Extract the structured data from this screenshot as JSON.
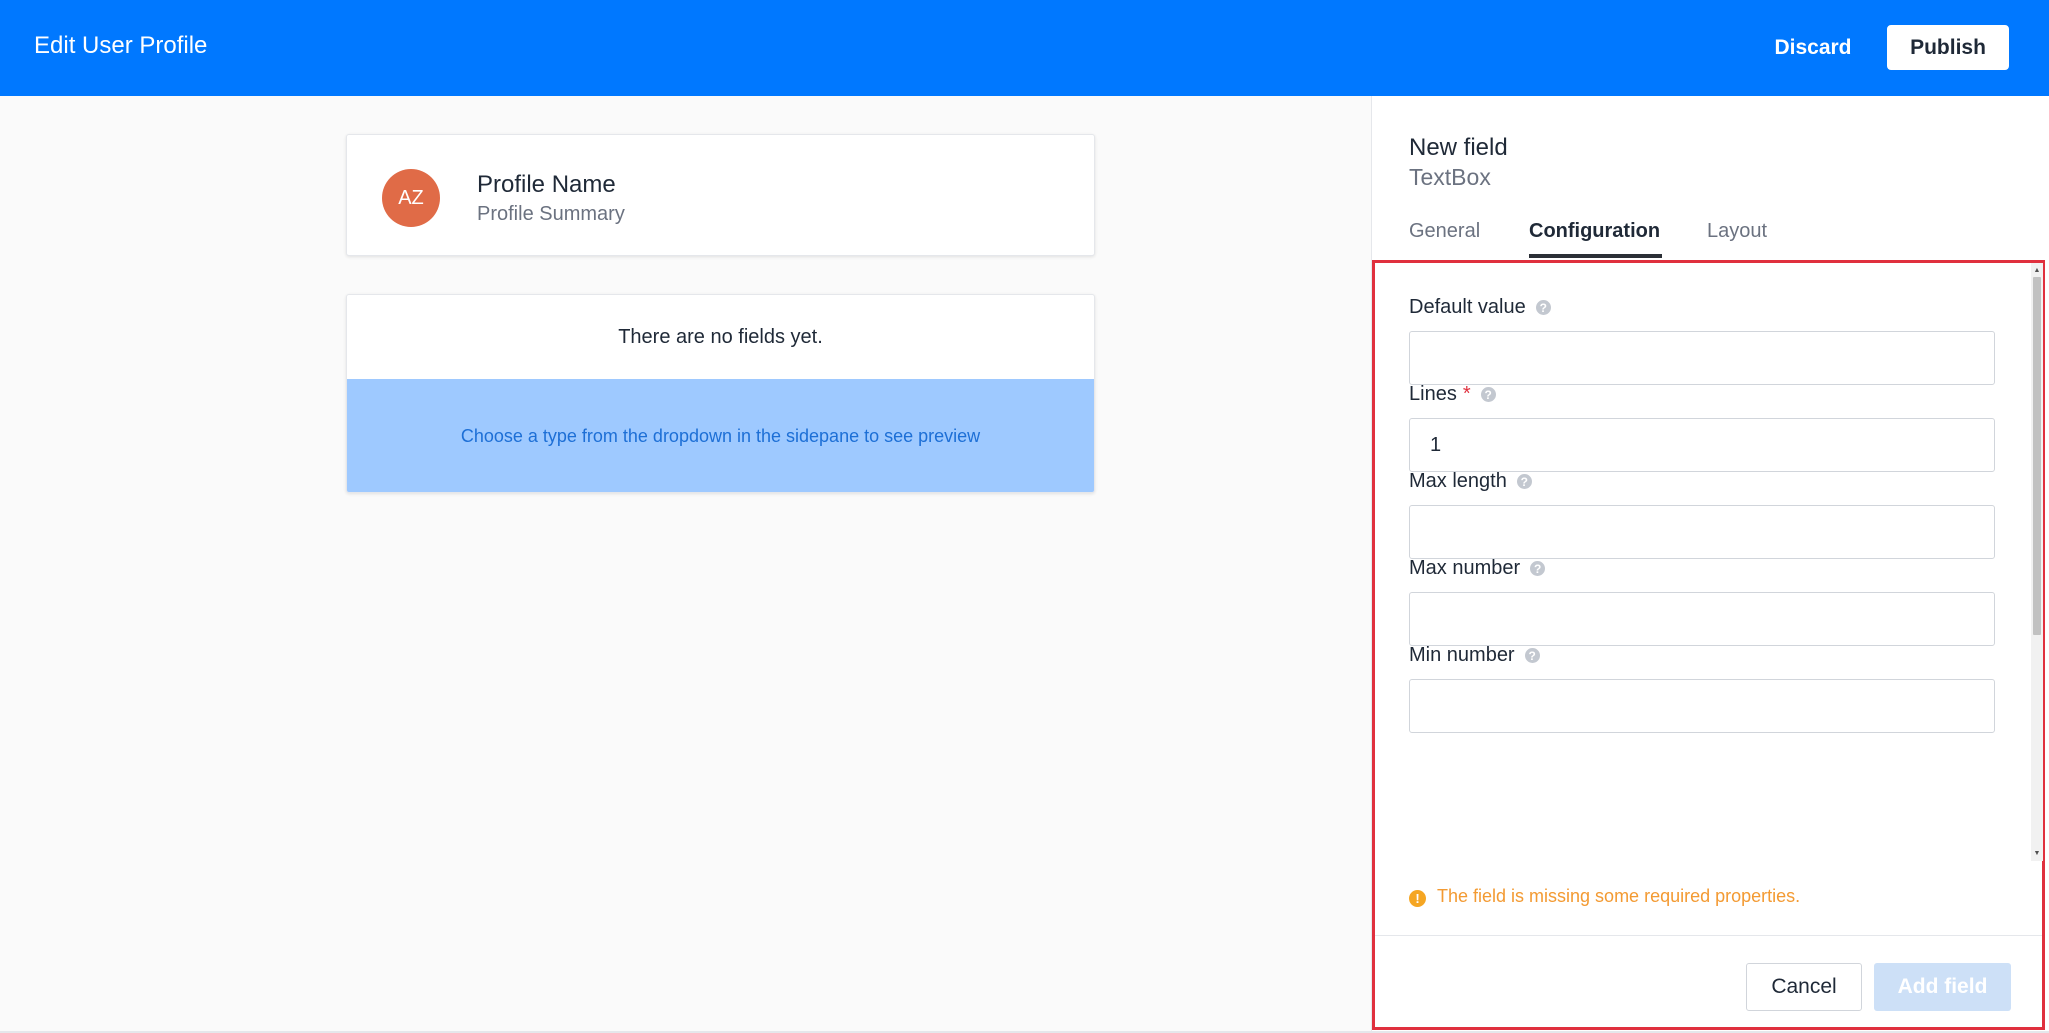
{
  "header": {
    "title": "Edit User Profile",
    "discard_label": "Discard",
    "publish_label": "Publish"
  },
  "colors": {
    "header_bg": "#0078ff",
    "avatar_bg": "#e06b47",
    "preview_bg": "#9ec9ff",
    "warning": "#f39a32",
    "highlight_border": "#e0303e"
  },
  "profile": {
    "initials": "AZ",
    "name": "Profile Name",
    "summary": "Profile Summary"
  },
  "fields_area": {
    "empty_message": "There are no fields yet.",
    "preview_hint": "Choose a type from the dropdown in the sidepane to see preview"
  },
  "sidepane": {
    "title": "New field",
    "type": "TextBox",
    "tabs": [
      {
        "label": "General",
        "active": false
      },
      {
        "label": "Configuration",
        "active": true
      },
      {
        "label": "Layout",
        "active": false
      }
    ],
    "form": {
      "fields": [
        {
          "label": "Default value",
          "required": false,
          "value": "",
          "help_icon": "question-circle-icon"
        },
        {
          "label": "Lines",
          "required": true,
          "required_mark": "*",
          "value": "1",
          "help_icon": "question-circle-icon"
        },
        {
          "label": "Max length",
          "required": false,
          "value": "",
          "help_icon": "question-circle-icon"
        },
        {
          "label": "Max number",
          "required": false,
          "value": "",
          "help_icon": "question-circle-icon"
        },
        {
          "label": "Min number",
          "required": false,
          "value": "",
          "help_icon": "question-circle-icon"
        }
      ]
    },
    "warning": {
      "icon": "exclamation-circle-icon",
      "text": "The field is missing some required properties."
    },
    "footer": {
      "cancel_label": "Cancel",
      "add_label": "Add field",
      "add_disabled": true
    }
  }
}
